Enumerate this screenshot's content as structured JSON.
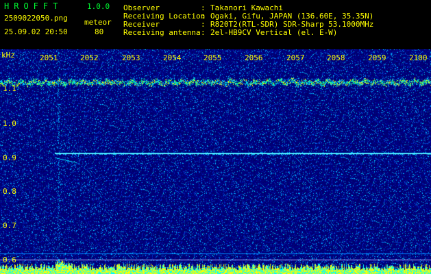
{
  "header": {
    "app_title": "HROFFT",
    "version": "1.0.0",
    "filename": "2509022050.png",
    "datetime": "25.09.02 20:50",
    "meteor_label": "meteor",
    "meteor_count": "80",
    "info_labels": [
      "Observer",
      "Receiving Location",
      "Receiver",
      "Receiving antenna"
    ],
    "info_colons": [
      ":",
      ":",
      ":",
      ":"
    ],
    "info_values": [
      "Takanori Kawachi",
      "Ogaki, Gifu, JAPAN (136.60E, 35.35N)",
      "R820T2(RTL-SDR) SDR-Sharp 53.1000MHz",
      "2el-HB9CV Vertical (el. E-W)"
    ]
  },
  "axis": {
    "unit": "kHz",
    "x_ticks": [
      "2051",
      "2052",
      "2053",
      "2054",
      "2055",
      "2056",
      "2057",
      "2058",
      "2059",
      "2100"
    ],
    "y_ticks": [
      "1.1",
      "1.0",
      "0.9",
      "0.8",
      "0.7",
      "0.6"
    ]
  },
  "colors": {
    "background": "#000000",
    "label_yellow": "#ffff00",
    "title_green": "#00ff33",
    "spectrogram_base": "#00008c"
  }
}
